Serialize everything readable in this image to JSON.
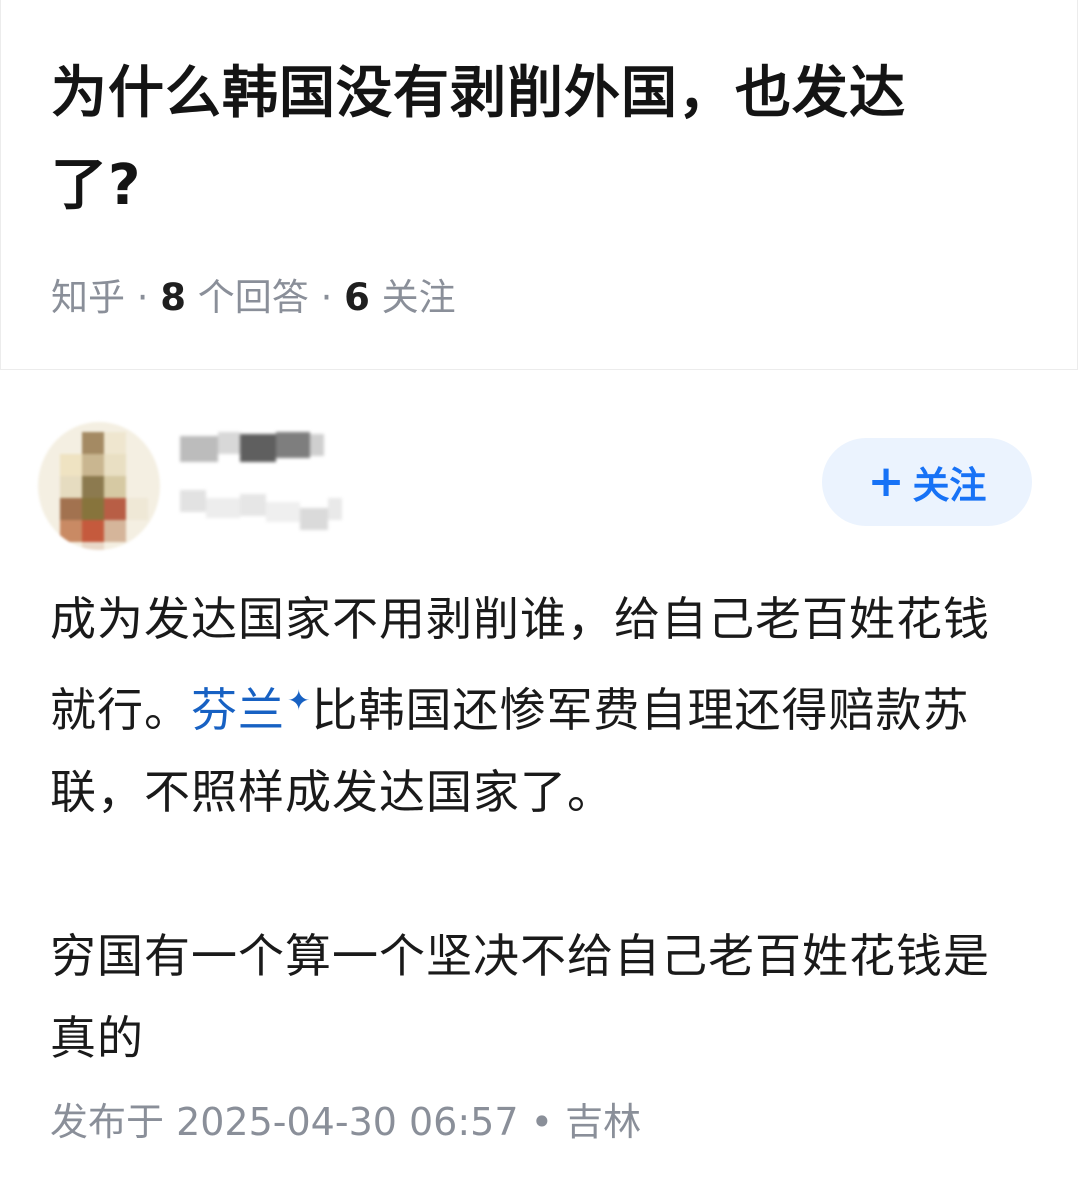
{
  "question": {
    "title": "为什么韩国没有剥削外国，也发达了?",
    "source": "知乎",
    "separator": " · ",
    "answer_count": "8",
    "answer_label": " 个回答",
    "follow_count": "6",
    "follow_label": " 关注"
  },
  "author": {
    "avatar_icon": "avatar-icon"
  },
  "follow_button": {
    "icon": "plus-icon",
    "label": "关注",
    "color": "#1772f6",
    "background": "#ebf3fe"
  },
  "answer": {
    "p1_before": "成为发达国家不用剥削谁，给自己老百姓花钱就行。",
    "p1_link": "芬兰",
    "p1_link_icon": "sparkle-icon",
    "p1_after": "比韩国还惨军费自理还得赔款苏联，不照样成发达国家了。",
    "p2": "穷国有一个算一个坚决不给自己老百姓花钱是真的",
    "link_color": "#1761c3"
  },
  "footer": {
    "published": "发布于 2025-04-30 06:57",
    "dot": " • ",
    "location": "吉林"
  }
}
